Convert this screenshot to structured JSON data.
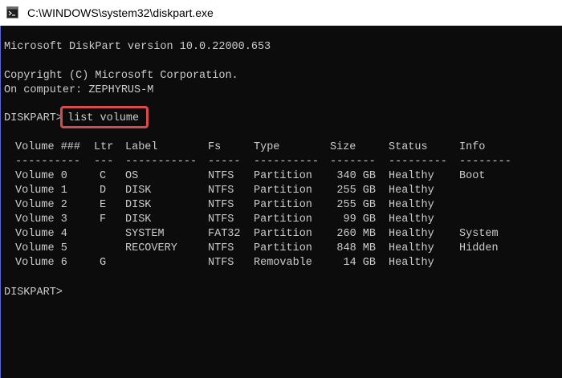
{
  "window": {
    "title": "C:\\WINDOWS\\system32\\diskpart.exe",
    "icon": "console-app-icon"
  },
  "console": {
    "version_line": "Microsoft DiskPart version 10.0.22000.653",
    "copyright_line": "Copyright (C) Microsoft Corporation.",
    "computer_line": "On computer: ZEPHYRUS-M",
    "prompt": "DISKPART>",
    "command": "list volume",
    "final_prompt": "DISKPART>"
  },
  "table": {
    "columns": [
      "Volume ###",
      "Ltr",
      "Label",
      "Fs",
      "Type",
      "Size",
      "Status",
      "Info"
    ],
    "separators": [
      "----------",
      "---",
      "-----------",
      "-----",
      "----------",
      "-------",
      "---------",
      "--------"
    ],
    "rows": [
      [
        "Volume 0",
        "C",
        "OS",
        "NTFS",
        "Partition",
        "340 GB",
        "Healthy",
        "Boot"
      ],
      [
        "Volume 1",
        "D",
        "DISK",
        "NTFS",
        "Partition",
        "255 GB",
        "Healthy",
        ""
      ],
      [
        "Volume 2",
        "E",
        "DISK",
        "NTFS",
        "Partition",
        "255 GB",
        "Healthy",
        ""
      ],
      [
        "Volume 3",
        "F",
        "DISK",
        "NTFS",
        "Partition",
        "99 GB",
        "Healthy",
        ""
      ],
      [
        "Volume 4",
        "",
        "SYSTEM",
        "FAT32",
        "Partition",
        "260 MB",
        "Healthy",
        "System"
      ],
      [
        "Volume 5",
        "",
        "RECOVERY",
        "NTFS",
        "Partition",
        "848 MB",
        "Healthy",
        "Hidden"
      ],
      [
        "Volume 6",
        "G",
        "",
        "NTFS",
        "Removable",
        "14 GB",
        "Healthy",
        ""
      ]
    ]
  },
  "colors": {
    "background": "#0c0c0c",
    "text": "#cccccc",
    "highlight": "#d94a4a"
  }
}
